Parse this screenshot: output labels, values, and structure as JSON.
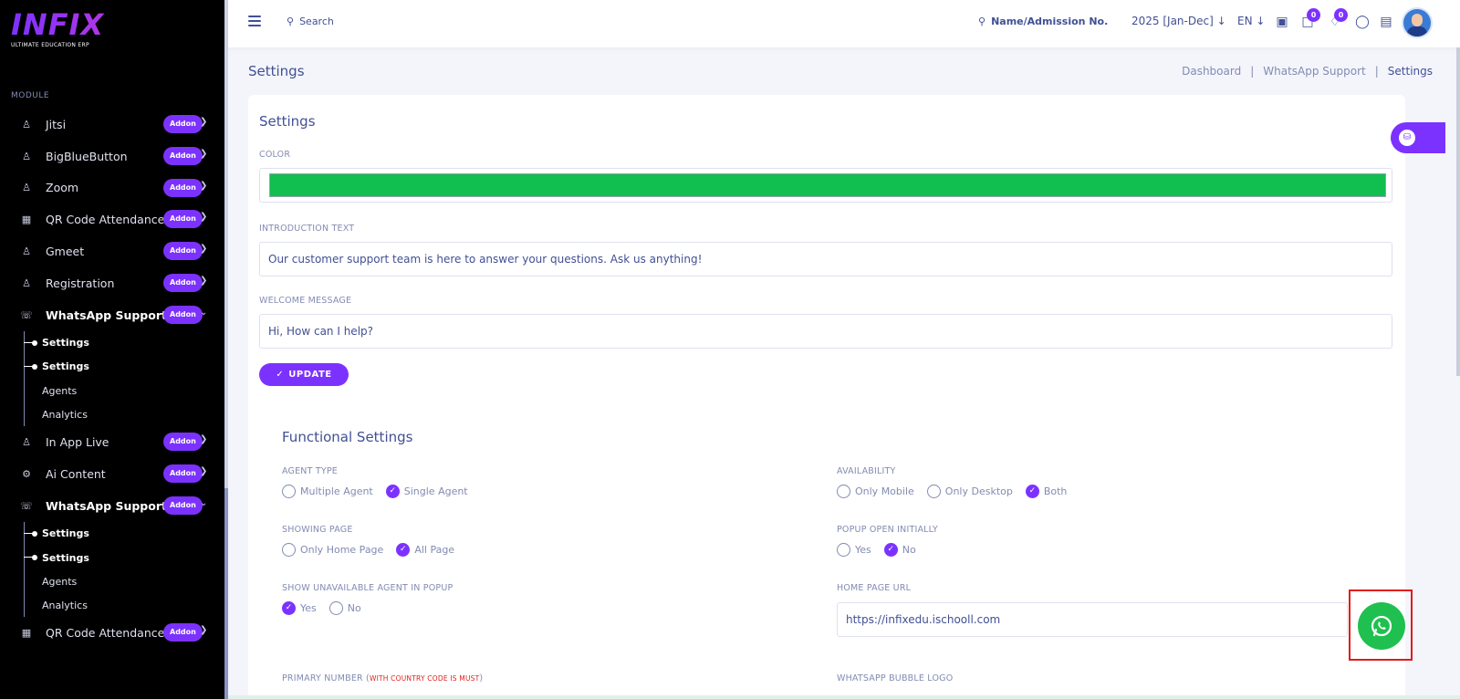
{
  "brand": {
    "logo": "INFIX",
    "tagline": "ULTIMATE EDUCATION ERP"
  },
  "sidebar": {
    "section_label": "MODULE",
    "addon_label": "Addon",
    "items": [
      {
        "label": "Jitsi",
        "icon": "person-icon"
      },
      {
        "label": "BigBlueButton",
        "icon": "person-icon"
      },
      {
        "label": "Zoom",
        "icon": "person-icon"
      },
      {
        "label": "QR Code Attendance",
        "icon": "grid-icon"
      },
      {
        "label": "Gmeet",
        "icon": "person-icon"
      },
      {
        "label": "Registration",
        "icon": "person-icon"
      },
      {
        "label": "WhatsApp Support",
        "icon": "whatsapp-icon",
        "expanded": true
      },
      {
        "label": "In App Live",
        "icon": "person-icon"
      },
      {
        "label": "Ai Content",
        "icon": "robot-icon"
      },
      {
        "label": "WhatsApp Support",
        "icon": "whatsapp-icon",
        "expanded": true
      },
      {
        "label": "QR Code Attendance",
        "icon": "grid-icon"
      }
    ],
    "submenu": [
      "Settings",
      "Settings",
      "Agents",
      "Analytics"
    ]
  },
  "header": {
    "search_placeholder": "Search",
    "student_search": "Name/Admission No.",
    "session": "2025 [Jan-Dec]",
    "language": "EN",
    "chat_count": "0",
    "notification_count": "0"
  },
  "page": {
    "title": "Settings",
    "breadcrumb": [
      "Dashboard",
      "WhatsApp Support",
      "Settings"
    ]
  },
  "form": {
    "title": "Settings",
    "color_label": "COLOR",
    "color_value": "#10bf4f",
    "intro_label": "INTRODUCTION TEXT",
    "intro_value": "Our customer support team is here to answer your questions. Ask us anything!",
    "welcome_label": "WELCOME MESSAGE",
    "welcome_value": "Hi, How can I help?",
    "update_button": "UPDATE"
  },
  "functional": {
    "title": "Functional Settings",
    "agent_type": {
      "label": "AGENT TYPE",
      "options": [
        "Multiple Agent",
        "Single Agent"
      ],
      "selected": "Single Agent"
    },
    "availability": {
      "label": "AVAILABILITY",
      "options": [
        "Only Mobile",
        "Only Desktop",
        "Both"
      ],
      "selected": "Both"
    },
    "showing_page": {
      "label": "SHOWING PAGE",
      "options": [
        "Only Home Page",
        "All Page"
      ],
      "selected": "All Page"
    },
    "popup_open": {
      "label": "POPUP OPEN INITIALLY",
      "options": [
        "Yes",
        "No"
      ],
      "selected": "No"
    },
    "show_unavailable": {
      "label": "SHOW UNAVAILABLE AGENT IN POPUP",
      "options": [
        "Yes",
        "No"
      ],
      "selected": "Yes"
    },
    "home_url_label": "HOME PAGE URL",
    "home_url_value": "https://infixedu.ischooll.com",
    "primary_number_label": "PRIMARY NUMBER (",
    "primary_number_note": "WITH COUNTRY CODE IS MUST",
    "primary_number_close": ")",
    "bubble_logo_label": "WHATSAPP BUBBLE LOGO"
  },
  "colors": {
    "accent": "#7c32ff",
    "whatsapp": "#1fc04f",
    "text": "#415094",
    "muted": "#828bb2"
  }
}
